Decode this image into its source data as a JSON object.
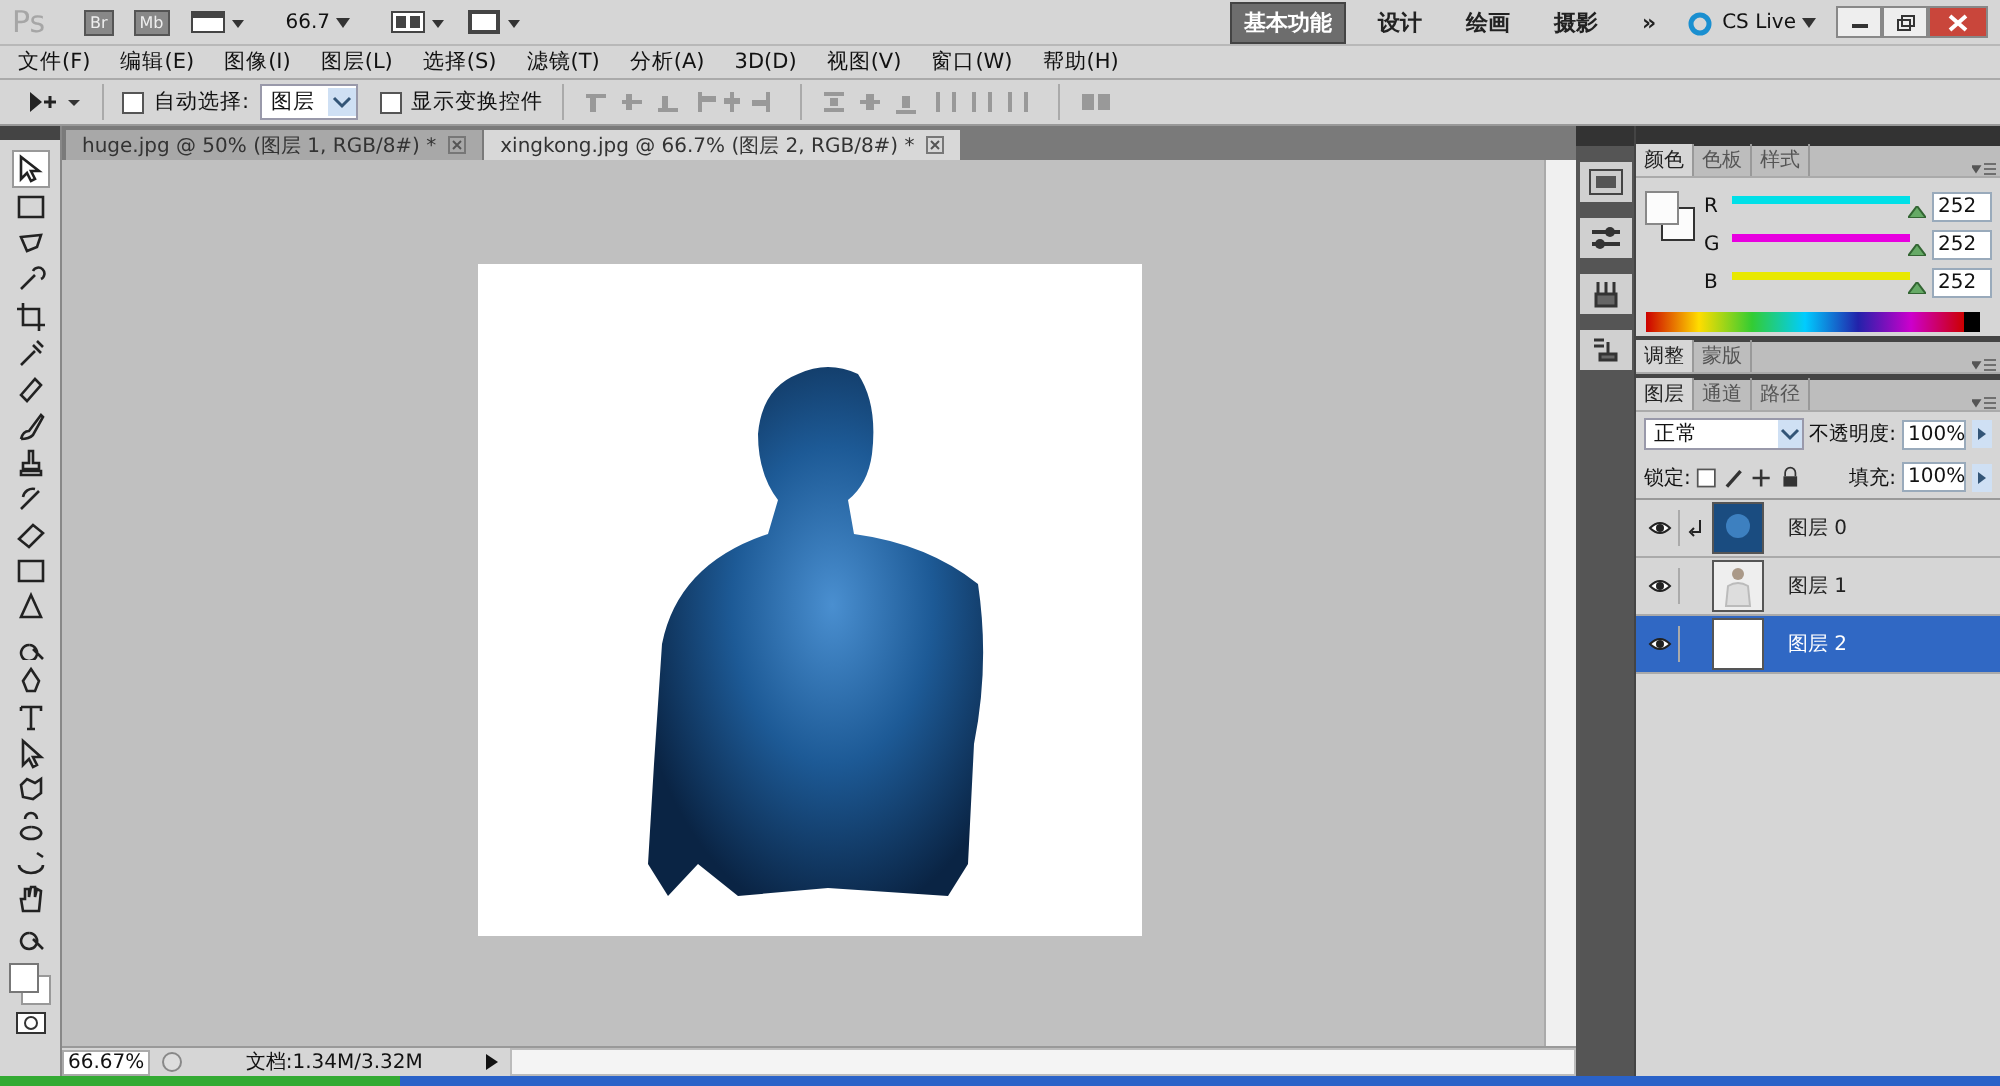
{
  "app_bar": {
    "logo": "Ps",
    "bridge": "Br",
    "mini_bridge": "Mb",
    "zoom": "66.7",
    "workspaces": [
      {
        "label": "基本功能",
        "selected": true
      },
      {
        "label": "设计",
        "selected": false
      },
      {
        "label": "绘画",
        "selected": false
      },
      {
        "label": "摄影",
        "selected": false
      }
    ],
    "more": "»",
    "cs_live": "CS Live"
  },
  "menu": [
    "文件(F)",
    "编辑(E)",
    "图像(I)",
    "图层(L)",
    "选择(S)",
    "滤镜(T)",
    "分析(A)",
    "3D(D)",
    "视图(V)",
    "窗口(W)",
    "帮助(H)"
  ],
  "options_bar": {
    "auto_select": {
      "label": "自动选择:",
      "checked": false
    },
    "auto_select_target": "图层",
    "show_transform": {
      "label": "显示变换控件",
      "checked": false
    }
  },
  "doc_tabs": [
    {
      "title": "huge.jpg @ 50% (图层 1, RGB/8#) *",
      "selected": false
    },
    {
      "title": "xingkong.jpg @ 66.7% (图层 2, RGB/8#) *",
      "selected": true
    }
  ],
  "color_panel": {
    "tabs": [
      {
        "label": "颜色",
        "selected": true
      },
      {
        "label": "色板",
        "selected": false
      },
      {
        "label": "样式",
        "selected": false
      }
    ],
    "channels": [
      {
        "name": "R",
        "value": "252",
        "level": 0.99,
        "color": "#00e0e8"
      },
      {
        "name": "G",
        "value": "252",
        "level": 0.99,
        "color": "#e800e0"
      },
      {
        "name": "B",
        "value": "252",
        "level": 0.99,
        "color": "#e8e800"
      }
    ]
  },
  "adjust_panel": {
    "tabs": [
      {
        "label": "调整",
        "selected": true
      },
      {
        "label": "蒙版",
        "selected": false
      }
    ]
  },
  "layers_panel": {
    "tabs": [
      {
        "label": "图层",
        "selected": true
      },
      {
        "label": "通道",
        "selected": false
      },
      {
        "label": "路径",
        "selected": false
      }
    ],
    "blend_mode": "正常",
    "opacity_label": "不透明度:",
    "opacity": "100%",
    "lock_label": "锁定:",
    "fill_label": "填充:",
    "fill": "100%",
    "layers": [
      {
        "name": "图层 0",
        "kind": "galaxy",
        "visible": true,
        "clipped": true,
        "selected": false
      },
      {
        "name": "图层 1",
        "kind": "person",
        "visible": true,
        "clipped": false,
        "selected": false
      },
      {
        "name": "图层 2",
        "kind": "blank",
        "visible": true,
        "clipped": false,
        "selected": true
      }
    ]
  },
  "status_bar": {
    "zoom": "66.67%",
    "doc": "文档:1.34M/3.32M"
  }
}
